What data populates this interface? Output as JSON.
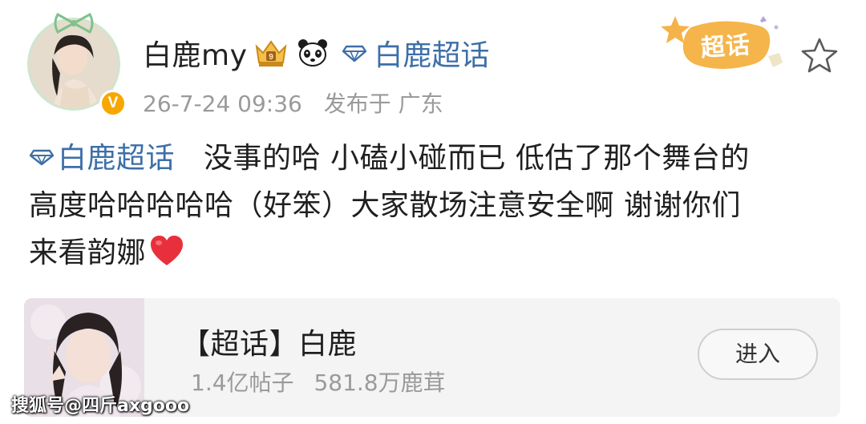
{
  "header": {
    "username": "白鹿my",
    "super_topic_name": "白鹿超话",
    "timestamp": "26-7-24 09:36",
    "post_source": "发布于 广东",
    "chaohua_badge_label": "超话"
  },
  "post": {
    "inline_topic": "白鹿超话",
    "line1": "没事的哈 小磕小碰而已 低估了那个舞台的",
    "line2": "高度哈哈哈哈哈（好笨）大家散场注意安全啊 谢谢你们",
    "line3": "来看韵娜",
    "emoji": "heart"
  },
  "topic_card": {
    "title": "【超话】白鹿",
    "posts_count": "1.4亿帖子",
    "followers_count": "581.8万鹿茸",
    "enter_button_label": "进入"
  },
  "watermark": "搜狐号@四斤axgooo",
  "colors": {
    "link_blue": "#3d6fa8",
    "meta_gray": "#9a9a9a",
    "badge_gold": "#f7a800",
    "heart_red": "#e8303c",
    "chaohua_orange": "#f5b54a"
  }
}
